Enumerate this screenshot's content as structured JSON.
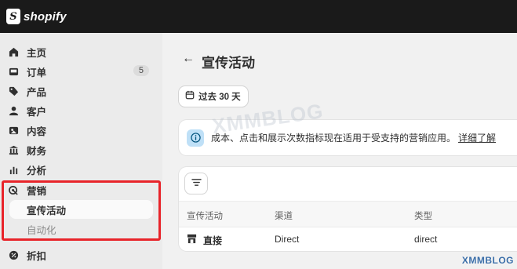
{
  "topbar": {
    "logo_text": "shopify",
    "logo_icon": "shopping-bag-icon"
  },
  "sidebar": {
    "items": [
      {
        "label": "主页",
        "icon": "home-icon"
      },
      {
        "label": "订单",
        "icon": "inbox-icon",
        "badge": "5"
      },
      {
        "label": "产品",
        "icon": "tag-icon"
      },
      {
        "label": "客户",
        "icon": "person-icon"
      },
      {
        "label": "内容",
        "icon": "content-icon"
      },
      {
        "label": "财务",
        "icon": "bank-icon"
      },
      {
        "label": "分析",
        "icon": "bar-chart-icon"
      },
      {
        "label": "营销",
        "icon": "target-icon"
      }
    ],
    "marketing_sub": {
      "campaigns": "宣传活动",
      "automation": "自动化"
    },
    "discounts": {
      "label": "折扣",
      "icon": "discount-icon"
    }
  },
  "main": {
    "title": "宣传活动",
    "date_button": "过去 30 天",
    "banner": {
      "text": "成本、点击和展示次数指标现在适用于受支持的营销应用。",
      "link": "详细了解"
    },
    "table": {
      "headers": [
        "宣传活动",
        "渠道",
        "类型"
      ],
      "rows": [
        {
          "campaign": "直接",
          "channel": "Direct",
          "type": "direct"
        }
      ]
    }
  },
  "watermark": {
    "center": "XMMBLOG",
    "corner": "XMMBLOG"
  },
  "colors": {
    "topbar": "#1a1a1a",
    "sidebar": "#ebebeb",
    "highlight": "#e8242a",
    "info": "#bfe0f7"
  }
}
